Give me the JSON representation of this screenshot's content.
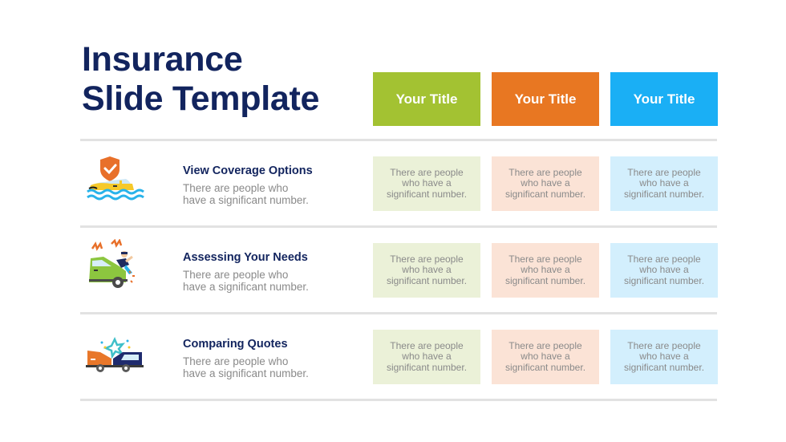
{
  "slide": {
    "title_line1": "Insurance",
    "title_line2": "Slide Template"
  },
  "columns": [
    {
      "label": "Your Title",
      "color": "#a3c232",
      "cell_color": "#ebf1d8"
    },
    {
      "label": "Your Title",
      "color": "#e87722",
      "cell_color": "#fbe3d6"
    },
    {
      "label": "Your Title",
      "color": "#1aaff5",
      "cell_color": "#d3effd"
    }
  ],
  "rows": [
    {
      "icon": "flooded-car-shield-icon",
      "title": "View Coverage Options",
      "desc_line1": "There are people who",
      "desc_line2": "have a significant number.",
      "cells": [
        {
          "line1": "There are people",
          "line2": "who have a",
          "line3": "significant number."
        },
        {
          "line1": "There are people",
          "line2": "who have a",
          "line3": "significant number."
        },
        {
          "line1": "There are people",
          "line2": "who have a",
          "line3": "significant number."
        }
      ]
    },
    {
      "icon": "car-accident-pedestrian-icon",
      "title": "Assessing Your Needs",
      "desc_line1": "There are people who",
      "desc_line2": "have a significant number.",
      "cells": [
        {
          "line1": "There are people",
          "line2": "who have a",
          "line3": "significant number."
        },
        {
          "line1": "There are people",
          "line2": "who have a",
          "line3": "significant number."
        },
        {
          "line1": "There are people",
          "line2": "who have a",
          "line3": "significant number."
        }
      ]
    },
    {
      "icon": "car-collision-icon",
      "title": "Comparing Quotes",
      "desc_line1": "There are people who",
      "desc_line2": "have a significant number.",
      "cells": [
        {
          "line1": "There are people",
          "line2": "who have a",
          "line3": "significant number."
        },
        {
          "line1": "There are people",
          "line2": "who have a",
          "line3": "significant number."
        },
        {
          "line1": "There are people",
          "line2": "who have a",
          "line3": "significant number."
        }
      ]
    }
  ],
  "colors": {
    "title": "#12245e",
    "body_text": "#8a8a8a",
    "divider": "#e2e2e2"
  }
}
